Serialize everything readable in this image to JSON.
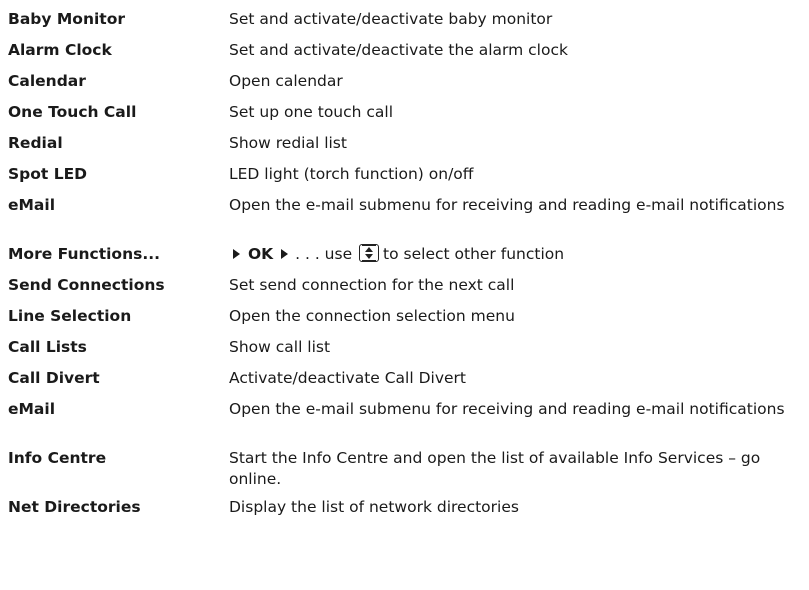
{
  "rows": [
    {
      "term": "Baby Monitor",
      "desc": "Set and activate/deactivate baby monitor"
    },
    {
      "term": "Alarm Clock",
      "desc": "Set and activate/deactivate the alarm clock"
    },
    {
      "term": "Calendar",
      "desc": "Open calendar"
    },
    {
      "term": "One Touch Call",
      "desc": "Set up one touch call"
    },
    {
      "term": "Redial",
      "desc": "Show redial list"
    },
    {
      "term": "Spot LED",
      "desc": "LED light (torch function) on/off"
    },
    {
      "term": "eMail",
      "desc": "Open the e-mail submenu for receiving and reading e-mail notifications"
    },
    {
      "term": "More Functions...",
      "desc_parts": {
        "ok": "OK",
        "dots": " . . . use ",
        "tail": "to select other function"
      }
    },
    {
      "term": "Send Connections",
      "desc": "Set send connection for the next call"
    },
    {
      "term": "Line Selection",
      "desc": "Open the connection selection menu"
    },
    {
      "term": "Call Lists",
      "desc": "Show call list"
    },
    {
      "term": "Call Divert",
      "desc": "Activate/deactivate Call Divert"
    },
    {
      "term": "eMail",
      "desc": "Open the e-mail submenu for receiving and reading e-mail notifications"
    },
    {
      "term": "Info Centre",
      "desc": "Start the Info Centre and open the list of available Info Services – go online."
    },
    {
      "term": "Net Directories",
      "desc": "Display the list of network directories"
    }
  ],
  "icons": {
    "arrow": "right-triangle-arrow-icon",
    "navkey": "up-down-navigation-key-icon"
  }
}
